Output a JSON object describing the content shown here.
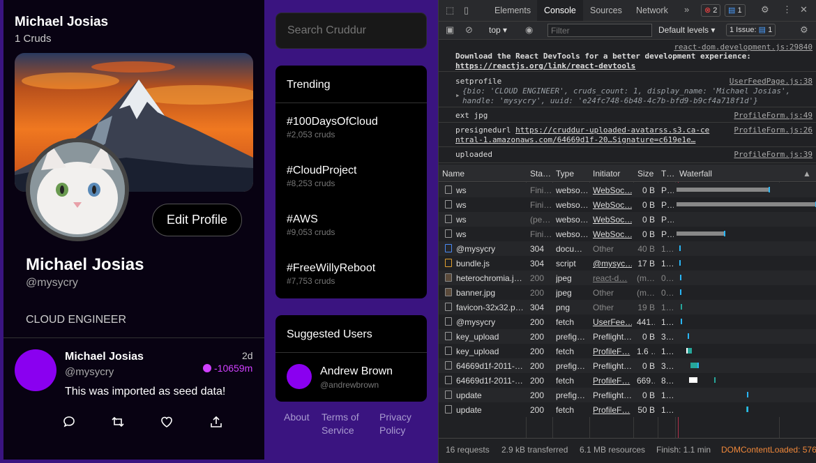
{
  "profile": {
    "title_name": "Michael Josias",
    "cruds_count": "1 Cruds",
    "edit_label": "Edit Profile",
    "display_name": "Michael Josias",
    "handle": "@mysycry",
    "bio": "CLOUD ENGINEER"
  },
  "crud": {
    "name": "Michael Josias",
    "handle": "@mysycry",
    "time": "2d",
    "expires": "-10659m",
    "message": "This was imported as seed data!"
  },
  "search": {
    "placeholder": "Search Cruddur"
  },
  "trending": {
    "title": "Trending",
    "items": [
      {
        "tag": "#100DaysOfCloud",
        "count": "#2,053 cruds"
      },
      {
        "tag": "#CloudProject",
        "count": "#8,253 cruds"
      },
      {
        "tag": "#AWS",
        "count": "#9,053 cruds"
      },
      {
        "tag": "#FreeWillyReboot",
        "count": "#7,753 cruds"
      }
    ]
  },
  "suggested": {
    "title": "Suggested Users",
    "user_name": "Andrew Brown",
    "user_handle": "@andrewbrown"
  },
  "footer": {
    "about": "About",
    "terms": "Terms of Service",
    "privacy": "Privacy Policy"
  },
  "devtools": {
    "tabs": [
      "Elements",
      "Console",
      "Sources",
      "Network"
    ],
    "errors": "2",
    "messages": "1",
    "context": "top",
    "filter_placeholder": "Filter",
    "levels": "Default levels",
    "issues": "1 Issue:",
    "issues_count": "1",
    "console": [
      {
        "src": "react-dom.development.js:29840",
        "text": "Download the React DevTools for a better development experience: ",
        "link": "https://reactjs.org/link/react-devtools"
      },
      {
        "src": "UserFeedPage.js:38",
        "text": "setprofile",
        "obj": "{bio: 'CLOUD ENGINEER', cruds_count: 1, display_name: 'Michael Josias', handle: 'mysycry', uuid: 'e24fc748-6b48-4c7b-bfd9-b9cf4a718f1d'}"
      },
      {
        "src": "ProfileForm.js:49",
        "text": "ext jpg"
      },
      {
        "src": "ProfileForm.js:26",
        "text": "presignedurl ",
        "link": "https://cruddur-uploaded-avatarss.s3.ca-central-1.amazonaws.com/64669d1f-20…Signature=c619e1e…"
      },
      {
        "src": "ProfileForm.js:39",
        "text": "uploaded"
      }
    ],
    "network": {
      "headers": [
        "Name",
        "Sta…",
        "Type",
        "Initiator",
        "Size",
        "T…",
        "Waterfall"
      ],
      "rows": [
        {
          "name": "ws",
          "status": "Fini…",
          "type": "webso…",
          "init": "WebSoc…",
          "size": "0 B",
          "time": "P…",
          "dim": false,
          "link": true,
          "icon": "doc-icon",
          "wf": [
            {
              "s": 0.0,
              "e": 0.66,
              "c": "#888"
            },
            {
              "s": 0.66,
              "e": 0.67,
              "c": "#29b6f6"
            }
          ]
        },
        {
          "name": "ws",
          "status": "Fini…",
          "type": "webso…",
          "init": "WebSoc…",
          "size": "0 B",
          "time": "P…",
          "dim": false,
          "link": true,
          "icon": "doc-icon",
          "wf": [
            {
              "s": 0.0,
              "e": 1.0,
              "c": "#888"
            },
            {
              "s": 0.995,
              "e": 1.0,
              "c": "#29b6f6"
            }
          ]
        },
        {
          "name": "ws",
          "status": "(pe…",
          "type": "webso…",
          "init": "WebSoc…",
          "size": "0 B",
          "time": "P…",
          "dim": false,
          "link": true,
          "icon": "doc-icon",
          "wf": []
        },
        {
          "name": "ws",
          "status": "Fini…",
          "type": "webso…",
          "init": "WebSoc…",
          "size": "0 B",
          "time": "P…",
          "dim": false,
          "link": true,
          "icon": "doc-icon",
          "wf": [
            {
              "s": 0.0,
              "e": 0.34,
              "c": "#888"
            },
            {
              "s": 0.34,
              "e": 0.35,
              "c": "#29b6f6"
            }
          ]
        },
        {
          "name": "@mysycry",
          "status": "304",
          "type": "docu…",
          "init": "Other",
          "size": "40 B",
          "time": "1…",
          "dim": true,
          "link": false,
          "icon": "document-icon",
          "wf": [
            {
              "s": 0.02,
              "e": 0.03,
              "c": "#29b6f6"
            }
          ]
        },
        {
          "name": "bundle.js",
          "status": "304",
          "type": "script",
          "init": "@mysyc…",
          "size": "17 B",
          "time": "1…",
          "dim": false,
          "link": true,
          "icon": "script-icon",
          "wf": [
            {
              "s": 0.02,
              "e": 0.03,
              "c": "#29b6f6"
            }
          ]
        },
        {
          "name": "heterochromia.j…",
          "status": "200",
          "type": "jpeg",
          "init": "react-d…",
          "size": "(m…",
          "time": "0…",
          "dim": true,
          "link": true,
          "icon": "image-icon",
          "wf": [
            {
              "s": 0.025,
              "e": 0.03,
              "c": "#29b6f6"
            }
          ]
        },
        {
          "name": "banner.jpg",
          "status": "200",
          "type": "jpeg",
          "init": "Other",
          "size": "(m…",
          "time": "0…",
          "dim": true,
          "link": false,
          "icon": "image-icon",
          "wf": [
            {
              "s": 0.025,
              "e": 0.03,
              "c": "#29b6f6"
            }
          ]
        },
        {
          "name": "favicon-32x32.p…",
          "status": "304",
          "type": "png",
          "init": "Other",
          "size": "19 B",
          "time": "1…",
          "dim": true,
          "link": false,
          "icon": "doc-icon",
          "wf": [
            {
              "s": 0.03,
              "e": 0.04,
              "c": "#26a69a"
            }
          ]
        },
        {
          "name": "@mysycry",
          "status": "200",
          "type": "fetch",
          "init": "UserFee…",
          "size": "441…",
          "time": "1…",
          "dim": false,
          "link": true,
          "icon": "doc-icon",
          "wf": [
            {
              "s": 0.03,
              "e": 0.04,
              "c": "#29b6f6"
            }
          ]
        },
        {
          "name": "key_upload",
          "status": "200",
          "type": "prefig…",
          "init": "Preflight…",
          "size": "0 B",
          "time": "3…",
          "dim": false,
          "link": false,
          "icon": "doc-icon",
          "wf": [
            {
              "s": 0.08,
              "e": 0.09,
              "c": "#29b6f6"
            }
          ]
        },
        {
          "name": "key_upload",
          "status": "200",
          "type": "fetch",
          "init": "ProfileF…",
          "size": "1.6 …",
          "time": "1…",
          "dim": false,
          "link": true,
          "icon": "doc-icon",
          "wf": [
            {
              "s": 0.07,
              "e": 0.08,
              "c": "#fff"
            },
            {
              "s": 0.08,
              "e": 0.11,
              "c": "#26a69a"
            }
          ]
        },
        {
          "name": "64669d1f-2011-…",
          "status": "200",
          "type": "prefig…",
          "init": "Preflight…",
          "size": "0 B",
          "time": "3…",
          "dim": false,
          "link": false,
          "icon": "doc-icon",
          "wf": [
            {
              "s": 0.1,
              "e": 0.15,
              "c": "#26a69a"
            },
            {
              "s": 0.15,
              "e": 0.16,
              "c": "#29b6f6"
            }
          ]
        },
        {
          "name": "64669d1f-2011-…",
          "status": "200",
          "type": "fetch",
          "init": "ProfileF…",
          "size": "669…",
          "time": "8…",
          "dim": false,
          "link": true,
          "icon": "doc-icon",
          "wf": [
            {
              "s": 0.09,
              "e": 0.15,
              "c": "#fff"
            },
            {
              "s": 0.27,
              "e": 0.28,
              "c": "#26a69a"
            }
          ]
        },
        {
          "name": "update",
          "status": "200",
          "type": "prefig…",
          "init": "Preflight…",
          "size": "0 B",
          "time": "1…",
          "dim": false,
          "link": false,
          "icon": "doc-icon",
          "wf": [
            {
              "s": 0.505,
              "e": 0.515,
              "c": "#29b6f6"
            }
          ]
        },
        {
          "name": "update",
          "status": "200",
          "type": "fetch",
          "init": "ProfileF…",
          "size": "50 B",
          "time": "1…",
          "dim": false,
          "link": true,
          "icon": "doc-icon",
          "wf": [
            {
              "s": 0.5,
              "e": 0.505,
              "c": "#26a69a"
            },
            {
              "s": 0.505,
              "e": 0.515,
              "c": "#29b6f6"
            }
          ]
        }
      ],
      "summary": {
        "requests": "16 requests",
        "transferred": "2.9 kB transferred",
        "resources": "6.1 MB resources",
        "finish": "Finish: 1.1 min",
        "dcl": "DOMContentLoaded: 576"
      }
    }
  },
  "colors": {
    "accent": "#8a00f0",
    "app_bg": "#3a1480",
    "panel_bg": "#080212",
    "expires": "#d040ff"
  }
}
